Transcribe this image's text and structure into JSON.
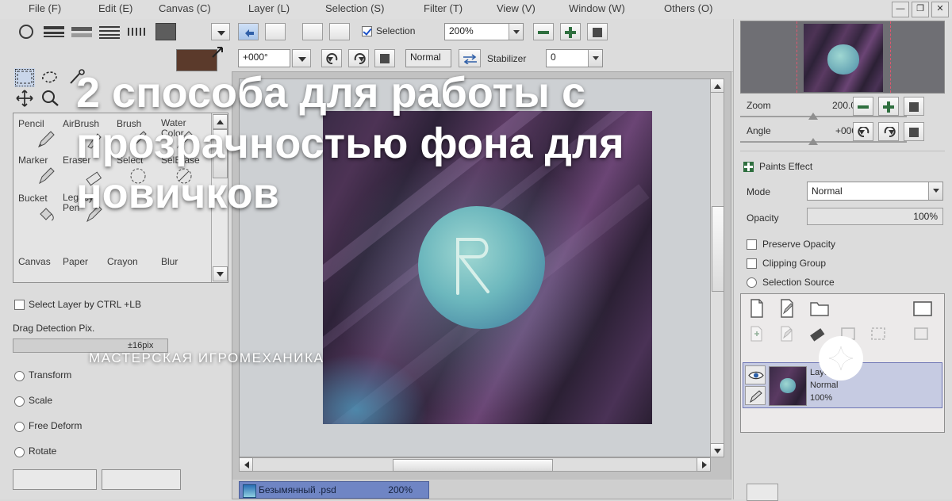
{
  "overlay": {
    "headline": "2 способа для работы с прозрачностью фона для новичков",
    "brand": "МАСТЕРСКАЯ ИГРОМЕХАНИКА"
  },
  "menubar": {
    "items": [
      {
        "label": "File (F)"
      },
      {
        "label": "Edit (E)"
      },
      {
        "label": "Canvas (C)"
      },
      {
        "label": "Layer (L)"
      },
      {
        "label": "Selection (S)"
      },
      {
        "label": "Filter (T)"
      },
      {
        "label": "View (V)"
      },
      {
        "label": "Window (W)"
      },
      {
        "label": "Others (O)"
      }
    ],
    "window_buttons": [
      {
        "name": "minimize",
        "glyph": "—"
      },
      {
        "name": "maximize",
        "glyph": "❐"
      },
      {
        "name": "close",
        "glyph": "✕"
      }
    ]
  },
  "toolbar_row1": {
    "selection_checkbox_label": "Selection",
    "selection_checked": true,
    "zoom_value": "200%"
  },
  "toolbar_row2": {
    "angle_value": "+000°",
    "blend_mode": "Normal",
    "stabilizer_label": "Stabilizer",
    "stabilizer_value": "0"
  },
  "brush_panel": {
    "row1": [
      "Pencil",
      "AirBrush",
      "Brush",
      "Water Color"
    ],
    "row2": [
      "Marker",
      "Eraser",
      "Select",
      "SelErase"
    ],
    "row3": [
      "Bucket",
      "Legacy Pen"
    ],
    "row4": [
      "Canvas",
      "Paper",
      "Crayon",
      "Blur"
    ]
  },
  "left_options": {
    "select_layer_label": "Select Layer by CTRL +LB",
    "select_layer_checked": false,
    "drag_detection_label": "Drag Detection Pix.",
    "drag_detection_value": "±16pix",
    "radios": [
      {
        "label": "Transform",
        "selected": false
      },
      {
        "label": "Scale",
        "selected": false
      },
      {
        "label": "Free Deform",
        "selected": false
      },
      {
        "label": "Rotate",
        "selected": false
      }
    ]
  },
  "canvas": {
    "tab_name": "Безымянный .psd",
    "tab_zoom": "200%"
  },
  "right_panel": {
    "zoom_label": "Zoom",
    "zoom_value": "200.0%",
    "angle_label": "Angle",
    "angle_value": "+000Я",
    "paints_effect_label": "Paints Effect",
    "mode_label": "Mode",
    "mode_value": "Normal",
    "opacity_label": "Opacity",
    "opacity_value": "100%",
    "checkboxes": [
      {
        "label": "Preserve Opacity",
        "checked": false
      },
      {
        "label": "Clipping Group",
        "checked": false
      }
    ],
    "radio": {
      "label": "Selection Source",
      "selected": false
    },
    "layer": {
      "name": "Layer 1",
      "mode": "Normal",
      "opacity": "100%"
    }
  },
  "colors": {
    "accent_blue": "#6f85c4",
    "panel_bg": "#dcdcdc",
    "menubar_bg": "#dedede",
    "guide_red": "#e1576f",
    "swatch": "#5b3a2b",
    "layer_selected": "#c6cbe2"
  }
}
